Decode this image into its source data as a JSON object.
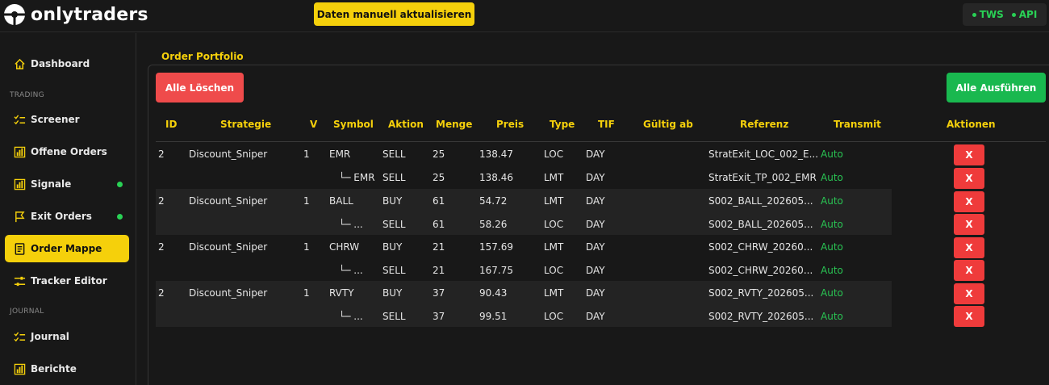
{
  "header": {
    "logo_text": "onlytraders",
    "refresh_button": "Daten manuell aktualisieren",
    "status": [
      {
        "label": "TWS",
        "color": "#29d155"
      },
      {
        "label": "API",
        "color": "#29d155"
      }
    ]
  },
  "sidebar": {
    "items": [
      {
        "label": "Dashboard",
        "icon": "home-icon",
        "active": false,
        "badge": false
      },
      {
        "label": "Screener",
        "icon": "checklist-icon",
        "active": false,
        "badge": false
      },
      {
        "label": "Offene Orders",
        "icon": "bar-chart-icon",
        "active": false,
        "badge": false
      },
      {
        "label": "Signale",
        "icon": "bar-chart-icon",
        "active": false,
        "badge": true
      },
      {
        "label": "Exit Orders",
        "icon": "flag-icon",
        "active": false,
        "badge": true
      },
      {
        "label": "Order Mappe",
        "icon": "document-icon",
        "active": true,
        "badge": false
      },
      {
        "label": "Tracker Editor",
        "icon": "sliders-icon",
        "active": false,
        "badge": false
      },
      {
        "label": "Journal",
        "icon": "checklist-icon",
        "active": false,
        "badge": false
      },
      {
        "label": "Berichte",
        "icon": "bar-chart-icon",
        "active": false,
        "badge": false
      }
    ],
    "sections": {
      "trading": "TRADING",
      "journal": "JOURNAL"
    }
  },
  "main": {
    "title": "Order Portfolio",
    "delete_all": "Alle Löschen",
    "execute_all": "Alle Ausführen",
    "columns": [
      "ID",
      "Strategie",
      "V",
      "Symbol",
      "Aktion",
      "Menge",
      "Preis",
      "Type",
      "TIF",
      "Gültig ab",
      "Referenz",
      "Transmit",
      "Aktionen"
    ],
    "rows": [
      {
        "id": "2",
        "strategie": "Discount_Sniper",
        "v": "1",
        "symbol": "EMR",
        "aktion": "SELL",
        "menge": "25",
        "preis": "138.47",
        "type": "LOC",
        "tif": "DAY",
        "gueltig": "",
        "referenz": "StratExit_LOC_002_E...",
        "transmit": "Auto",
        "action": "X"
      },
      {
        "id": "",
        "strategie": "",
        "v": "",
        "symbol": "└─ EMR",
        "aktion": "SELL",
        "menge": "25",
        "preis": "138.46",
        "type": "LMT",
        "tif": "DAY",
        "gueltig": "",
        "referenz": "StratExit_TP_002_EMR",
        "transmit": "Auto",
        "action": "X"
      },
      {
        "id": "2",
        "strategie": "Discount_Sniper",
        "v": "1",
        "symbol": "BALL",
        "aktion": "BUY",
        "menge": "61",
        "preis": "54.72",
        "type": "LMT",
        "tif": "DAY",
        "gueltig": "",
        "referenz": "S002_BALL_202605...",
        "transmit": "Auto",
        "action": "X"
      },
      {
        "id": "",
        "strategie": "",
        "v": "",
        "symbol": "└─ ...",
        "aktion": "SELL",
        "menge": "61",
        "preis": "58.26",
        "type": "LOC",
        "tif": "DAY",
        "gueltig": "",
        "referenz": "S002_BALL_202605...",
        "transmit": "Auto",
        "action": "X"
      },
      {
        "id": "2",
        "strategie": "Discount_Sniper",
        "v": "1",
        "symbol": "CHRW",
        "aktion": "BUY",
        "menge": "21",
        "preis": "157.69",
        "type": "LMT",
        "tif": "DAY",
        "gueltig": "",
        "referenz": "S002_CHRW_20260...",
        "transmit": "Auto",
        "action": "X"
      },
      {
        "id": "",
        "strategie": "",
        "v": "",
        "symbol": "└─ ...",
        "aktion": "SELL",
        "menge": "21",
        "preis": "167.75",
        "type": "LOC",
        "tif": "DAY",
        "gueltig": "",
        "referenz": "S002_CHRW_20260...",
        "transmit": "Auto",
        "action": "X"
      },
      {
        "id": "2",
        "strategie": "Discount_Sniper",
        "v": "1",
        "symbol": "RVTY",
        "aktion": "BUY",
        "menge": "37",
        "preis": "90.43",
        "type": "LMT",
        "tif": "DAY",
        "gueltig": "",
        "referenz": "S002_RVTY_202605...",
        "transmit": "Auto",
        "action": "X"
      },
      {
        "id": "",
        "strategie": "",
        "v": "",
        "symbol": "└─ ...",
        "aktion": "SELL",
        "menge": "37",
        "preis": "99.51",
        "type": "LOC",
        "tif": "DAY",
        "gueltig": "",
        "referenz": "S002_RVTY_202605...",
        "transmit": "Auto",
        "action": "X"
      }
    ]
  },
  "colors": {
    "accent": "#f5d00b",
    "danger": "#ef4b4b",
    "success": "#19b84f",
    "status_green": "#29d155",
    "background": "#181818"
  }
}
